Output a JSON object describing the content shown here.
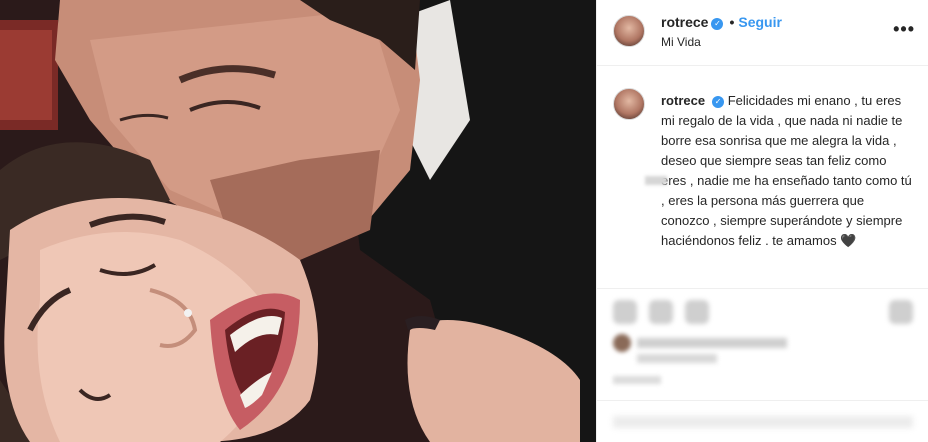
{
  "post": {
    "photo_alt": "",
    "author": {
      "username": "rotrece",
      "verified": true,
      "verified_glyph": "✓",
      "location": "Mi Vida"
    },
    "header": {
      "separator": "•",
      "follow_label": "Seguir",
      "more_icon": "more-horizontal-icon",
      "more_glyph": "•••"
    },
    "caption": {
      "username": "rotrece",
      "text": "Felicidades mi enano , tu eres mi regalo de la vida , que nada ni nadie te borre esa sonrisa que me alegra la vida , deseo que siempre seas tan feliz como eres , nadie me ha enseñado tanto como tú , eres la persona más guerrera que conozco , siempre superándote y siempre haciéndonos feliz . te amamos",
      "emoji": "🖤"
    },
    "actions": [
      {
        "name": "like-icon"
      },
      {
        "name": "comment-icon"
      },
      {
        "name": "share-icon"
      },
      {
        "name": "save-icon"
      }
    ],
    "colors": {
      "accent": "#3897f0",
      "text": "#262626",
      "border": "#efefef"
    }
  }
}
